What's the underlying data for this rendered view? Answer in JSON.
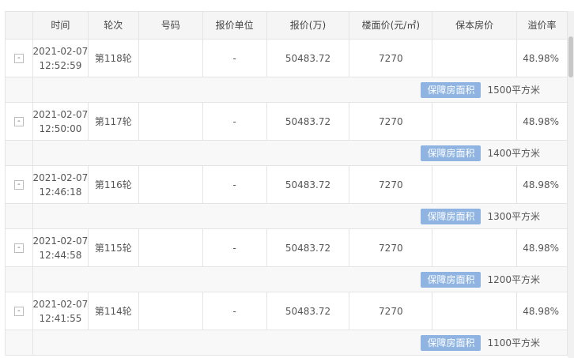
{
  "headers": [
    "",
    "时间",
    "轮次",
    "号码",
    "报价单位",
    "报价(万)",
    "楼面价(元/㎡)",
    "保本房价",
    "溢价率"
  ],
  "rows": [
    {
      "toggle": "-",
      "date": "2021-02-07",
      "time": "12:52:59",
      "round": "第118轮",
      "number": "",
      "bidder": "-",
      "price": "50483.72",
      "floor_price": "7270",
      "breakeven": "",
      "premium": "48.98%",
      "badge": "保障房面积",
      "area": "1500平方米"
    },
    {
      "toggle": "-",
      "date": "2021-02-07",
      "time": "12:50:00",
      "round": "第117轮",
      "number": "",
      "bidder": "-",
      "price": "50483.72",
      "floor_price": "7270",
      "breakeven": "",
      "premium": "48.98%",
      "badge": "保障房面积",
      "area": "1400平方米"
    },
    {
      "toggle": "-",
      "date": "2021-02-07",
      "time": "12:46:18",
      "round": "第116轮",
      "number": "",
      "bidder": "-",
      "price": "50483.72",
      "floor_price": "7270",
      "breakeven": "",
      "premium": "48.98%",
      "badge": "保障房面积",
      "area": "1300平方米"
    },
    {
      "toggle": "-",
      "date": "2021-02-07",
      "time": "12:44:58",
      "round": "第115轮",
      "number": "",
      "bidder": "-",
      "price": "50483.72",
      "floor_price": "7270",
      "breakeven": "",
      "premium": "48.98%",
      "badge": "保障房面积",
      "area": "1200平方米"
    },
    {
      "toggle": "-",
      "date": "2021-02-07",
      "time": "12:41:55",
      "round": "第114轮",
      "number": "",
      "bidder": "-",
      "price": "50483.72",
      "floor_price": "7270",
      "breakeven": "",
      "premium": "48.98%",
      "badge": "保障房面积",
      "area": "1100平方米"
    }
  ]
}
